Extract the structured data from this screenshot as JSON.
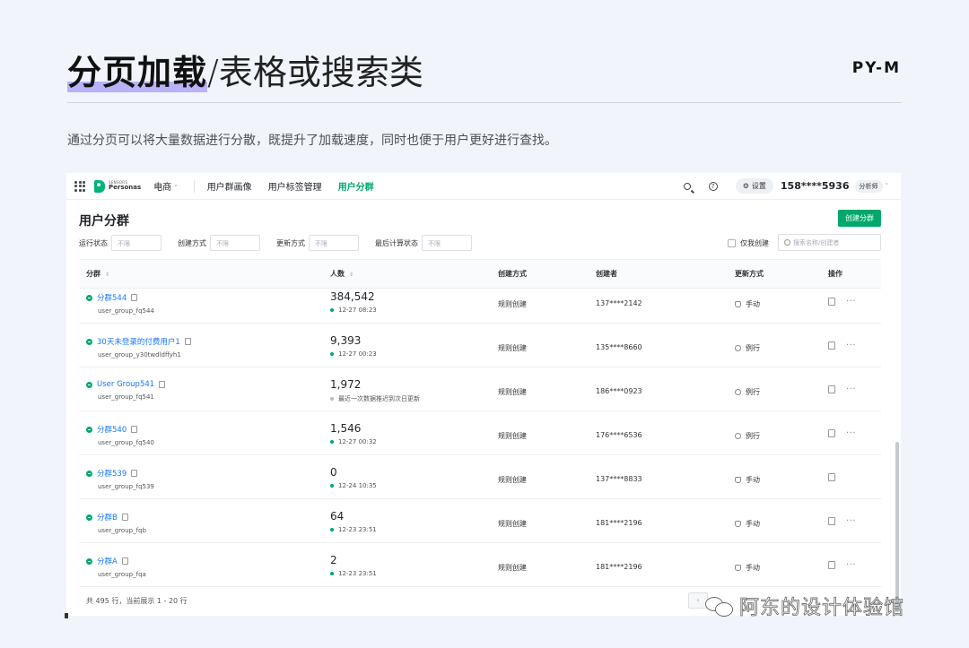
{
  "slide": {
    "title_bold": "分页加载",
    "title_rest": "/表格或搜索类",
    "brand": "PY-M",
    "subtitle": "通过分页可以将大量数据进行分散，既提升了加载速度，同时也便于用户更好进行查找。"
  },
  "topbar": {
    "logo_small": "SENSORS",
    "logo_big": "Personas",
    "nav": [
      "电商",
      "用户群画像",
      "用户标签管理",
      "用户分群"
    ],
    "active_nav": "用户分群",
    "settings_label": "设置",
    "user_phone": "158****5936",
    "role": "分析师"
  },
  "page": {
    "heading": "用户分群",
    "create_button": "创建分群",
    "filters": [
      {
        "label": "运行状态",
        "value": "不限"
      },
      {
        "label": "创建方式",
        "value": "不限"
      },
      {
        "label": "更新方式",
        "value": "不限"
      },
      {
        "label": "最后计算状态",
        "value": "不限"
      }
    ],
    "only_mine_label": "仅我创建",
    "search_placeholder": "搜索名称/创建者"
  },
  "table": {
    "headers": {
      "group": "分群",
      "count": "人数",
      "method": "创建方式",
      "creator": "创建者",
      "update": "更新方式",
      "ops": "操作"
    },
    "rows": [
      {
        "name": "分群544",
        "id": "user_group_fq544",
        "count": "384,542",
        "time": "12-27 08:23",
        "method": "规则创建",
        "creator": "137****2142",
        "update": "手动",
        "update_icon": "hand-icon",
        "more": true
      },
      {
        "name": "30天未登录的付费用户1",
        "id": "user_group_y30twdldffyh1",
        "count": "9,393",
        "time": "12-27 00:23",
        "method": "规则创建",
        "creator": "135****8660",
        "update": "例行",
        "update_icon": "clock-icon",
        "more": true
      },
      {
        "name": "User Group541",
        "id": "user_group_fq541",
        "count": "1,972",
        "time": "最近一次数据推迟到次日更新",
        "time_grey": true,
        "method": "规则创建",
        "creator": "186****0923",
        "update": "例行",
        "update_icon": "clock-icon",
        "more": true
      },
      {
        "name": "分群540",
        "id": "user_group_fq540",
        "count": "1,546",
        "time": "12-27 00:32",
        "method": "规则创建",
        "creator": "176****6536",
        "update": "例行",
        "update_icon": "clock-icon",
        "more": true
      },
      {
        "name": "分群539",
        "id": "user_group_fq539",
        "count": "0",
        "time": "12-24 10:35",
        "method": "规则创建",
        "creator": "137****8833",
        "update": "手动",
        "update_icon": "hand-icon",
        "more": false
      },
      {
        "name": "分群B",
        "id": "user_group_fqb",
        "count": "64",
        "time": "12-23 23:51",
        "method": "规则创建",
        "creator": "181****2196",
        "update": "手动",
        "update_icon": "hand-icon",
        "more": true
      },
      {
        "name": "分群A",
        "id": "user_group_fqa",
        "count": "2",
        "time": "12-23 23:51",
        "method": "规则创建",
        "creator": "181****2196",
        "update": "手动",
        "update_icon": "hand-icon",
        "more": true
      }
    ],
    "footer": "共 495 行，当前展示 1 - 20 行"
  },
  "watermark": "阿东的设计体验馆"
}
